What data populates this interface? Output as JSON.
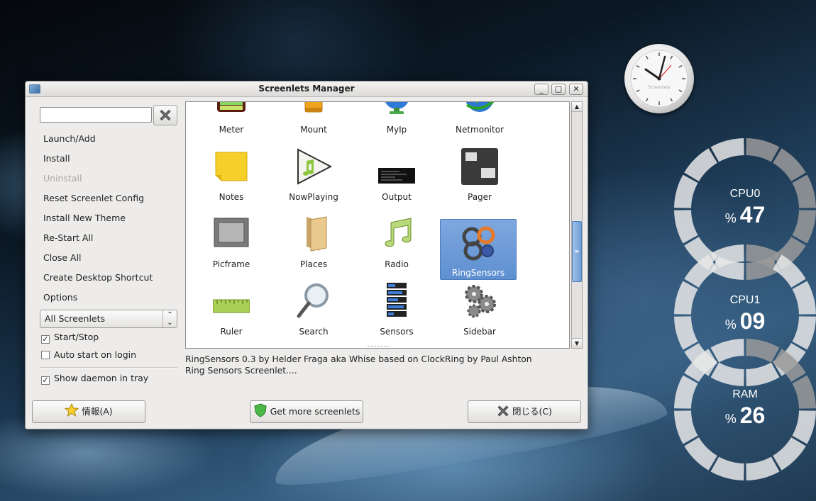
{
  "window": {
    "title": "Screenlets Manager",
    "controls": {
      "minimize": "_",
      "maximize": "□",
      "close": "✕"
    }
  },
  "search": {
    "value": "",
    "placeholder": ""
  },
  "actions": [
    {
      "label": "Launch/Add",
      "enabled": true
    },
    {
      "label": "Install",
      "enabled": true
    },
    {
      "label": "Uninstall",
      "enabled": false
    },
    {
      "label": "Reset Screenlet Config",
      "enabled": true
    },
    {
      "label": "Install New Theme",
      "enabled": true
    },
    {
      "label": "Re-Start All",
      "enabled": true
    },
    {
      "label": "Close All",
      "enabled": true
    },
    {
      "label": "Create Desktop Shortcut",
      "enabled": true
    },
    {
      "label": "Options",
      "enabled": true
    }
  ],
  "filter": {
    "selected": "All Screenlets"
  },
  "checkboxes": {
    "start_stop": {
      "label": "Start/Stop",
      "checked": true
    },
    "auto_start": {
      "label": "Auto start on login",
      "checked": false
    },
    "show_daemon": {
      "label": "Show daemon in tray",
      "checked": true
    }
  },
  "screenlets": [
    {
      "name": "Meter",
      "icon": "meter-icon",
      "selected": false
    },
    {
      "name": "Mount",
      "icon": "mount-icon",
      "selected": false
    },
    {
      "name": "MyIp",
      "icon": "myip-icon",
      "selected": false
    },
    {
      "name": "Netmonitor",
      "icon": "netmonitor-icon",
      "selected": false
    },
    {
      "name": "Notes",
      "icon": "notes-icon",
      "selected": false
    },
    {
      "name": "NowPlaying",
      "icon": "nowplaying-icon",
      "selected": false
    },
    {
      "name": "Output",
      "icon": "output-icon",
      "selected": false
    },
    {
      "name": "Pager",
      "icon": "pager-icon",
      "selected": false
    },
    {
      "name": "Picframe",
      "icon": "picframe-icon",
      "selected": false
    },
    {
      "name": "Places",
      "icon": "places-icon",
      "selected": false
    },
    {
      "name": "Radio",
      "icon": "radio-icon",
      "selected": false
    },
    {
      "name": "RingSensors",
      "icon": "ringsensors-icon",
      "selected": true
    },
    {
      "name": "Ruler",
      "icon": "ruler-icon",
      "selected": false
    },
    {
      "name": "Search",
      "icon": "search-icon",
      "selected": false
    },
    {
      "name": "Sensors",
      "icon": "sensors-icon",
      "selected": false
    },
    {
      "name": "Sidebar",
      "icon": "sidebar-icon",
      "selected": false
    }
  ],
  "description": {
    "line1": "RingSensors 0.3 by Helder Fraga aka Whise based on ClockRing by Paul Ashton",
    "line2": "Ring Sensors Screenlet...."
  },
  "buttons": {
    "info": "情報(A)",
    "get_more": "Get more screenlets",
    "close": "閉じる(C)"
  },
  "clock": {
    "brand": "Screenlets"
  },
  "sensors": [
    {
      "name": "CPU0",
      "unit": "%",
      "value": "47"
    },
    {
      "name": "CPU1",
      "unit": "%",
      "value": "09"
    },
    {
      "name": "RAM",
      "unit": "%",
      "value": "26"
    }
  ],
  "colors": {
    "selection": "#6f9ad6",
    "window_bg": "#edeceb",
    "ring_light": "#e8e8e8",
    "ring_dark": "#9a9a9a"
  }
}
